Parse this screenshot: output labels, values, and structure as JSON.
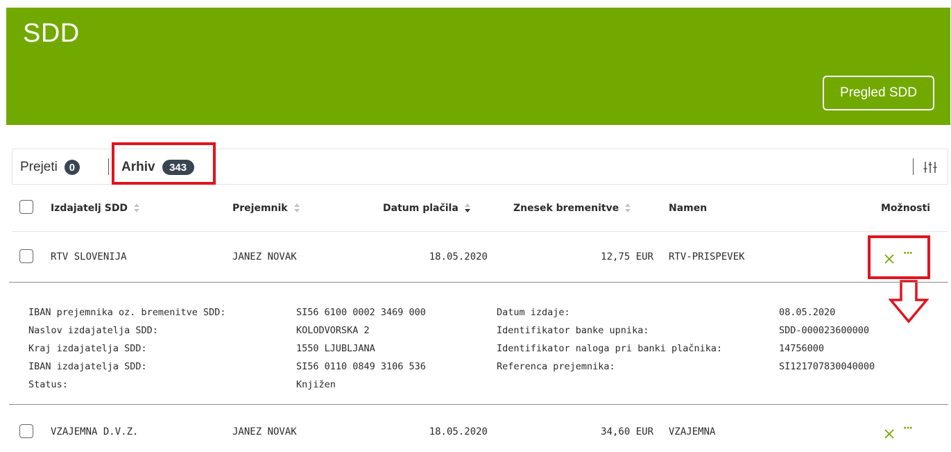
{
  "header": {
    "title": "SDD",
    "overview_button": "Pregled SDD",
    "bg_color": "#72a900"
  },
  "tabs": [
    {
      "label": "Prejeti",
      "count": "0"
    },
    {
      "label": "Arhiv",
      "count": "343",
      "active": true
    }
  ],
  "table": {
    "columns": [
      {
        "label": "Izdajatelj SDD",
        "sortable": true
      },
      {
        "label": "Prejemnik",
        "sortable": true
      },
      {
        "label": "Datum plačila",
        "sortable": true,
        "active_sort": "desc"
      },
      {
        "label": "Znesek bremenitve",
        "sortable": true
      },
      {
        "label": "Namen",
        "sortable": false
      },
      {
        "label": "Možnosti",
        "sortable": false
      }
    ],
    "rows": [
      {
        "issuer": "RTV SLOVENIJA",
        "recipient": "JANEZ NOVAK",
        "payment_date": "18.05.2020",
        "amount": "12,75 EUR",
        "purpose": "RTV-PRISPEVEK",
        "expanded": true
      },
      {
        "issuer": "VZAJEMNA D.V.Z.",
        "recipient": "JANEZ NOVAK",
        "payment_date": "18.05.2020",
        "amount": "34,60 EUR",
        "purpose": "VZAJEMNA",
        "expanded": false
      }
    ]
  },
  "details": {
    "left": [
      {
        "label": "IBAN prejemnika oz. bremenitve SDD:",
        "value": "SI56 6100 0002 3469 000"
      },
      {
        "label": "Naslov izdajatelja SDD:",
        "value": "KOLODVORSKA 2"
      },
      {
        "label": "Kraj izdajatelja SDD:",
        "value": "1550 LJUBLJANA"
      },
      {
        "label": "IBAN izdajatelja SDD:",
        "value": "SI56 0110 0849 3106 536"
      },
      {
        "label": "Status:",
        "value": "Knjižen"
      }
    ],
    "right": [
      {
        "label": "Datum izdaje:",
        "value": "08.05.2020"
      },
      {
        "label": "Identifikator banke upnika:",
        "value": "SDD-000023600000"
      },
      {
        "label": "Identifikator naloga pri banki plačnika:",
        "value": "14756000"
      },
      {
        "label": "Referenca prejemnika:",
        "value": "SI121707830040000"
      }
    ]
  },
  "icons": {
    "reject": "close-icon",
    "more": "more-icon",
    "filter": "sliders-icon"
  },
  "colors": {
    "accent_green": "#72a900",
    "badge": "#3b4552",
    "highlight": "#e0141e"
  }
}
